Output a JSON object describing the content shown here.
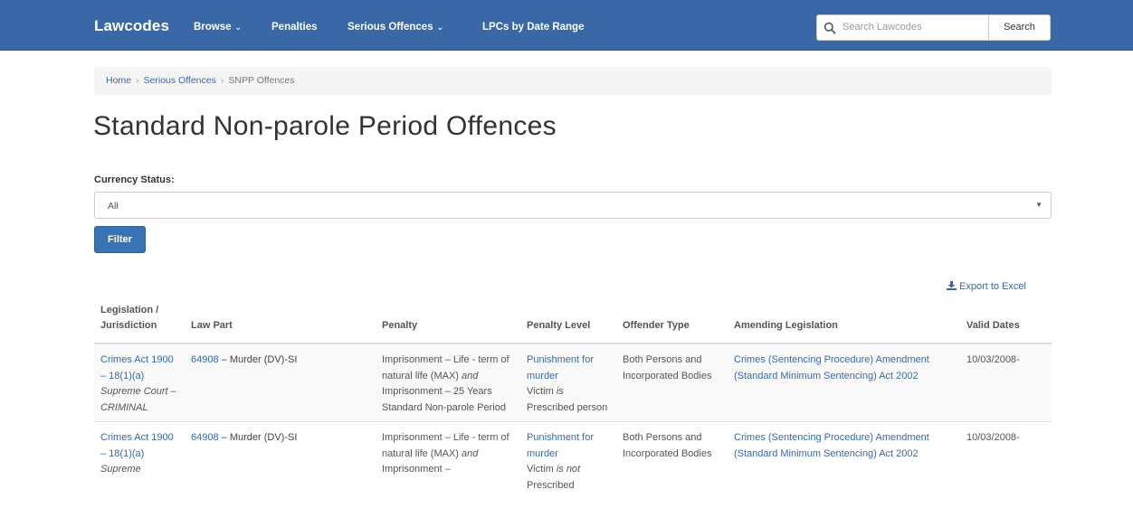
{
  "navbar": {
    "brand": "Lawcodes",
    "links": [
      {
        "label": "Browse",
        "caret": "⌄"
      },
      {
        "label": "Penalties",
        "caret": ""
      },
      {
        "label": "Serious Offences",
        "caret": "⌄"
      },
      {
        "label": "LPCs by Date Range",
        "caret": ""
      }
    ],
    "search_placeholder": "Search Lawcodes",
    "search_button": "Search"
  },
  "breadcrumb": {
    "home": "Home",
    "serious": "Serious Offences",
    "current": "SNPP Offences",
    "separator": "›"
  },
  "page_title": "Standard Non-parole Period Offences",
  "filter": {
    "label": "Currency Status:",
    "selected": "All",
    "button": "Filter"
  },
  "export_label": "Export to Excel",
  "table": {
    "headers": {
      "legislation": "Legislation / Jurisdiction",
      "law_part": "Law Part",
      "penalty": "Penalty",
      "penalty_level": "Penalty Level",
      "offender_type": "Offender Type",
      "amending": "Amending Legislation",
      "valid_dates": "Valid Dates"
    },
    "rows": [
      {
        "leg_link": "Crimes Act 1900 – 18(1)(a)",
        "jurisdiction": "Supreme Court – CRIMINAL",
        "law_code": "64908",
        "law_text": "– Murder (DV)-SI",
        "penalty_1": "Imprisonment – Life - term of natural life (MAX)",
        "penalty_and": "and",
        "penalty_2": "Imprisonment – 25 Years Standard Non-parole Period",
        "level_link": "Punishment for murder",
        "level_pre": "Victim",
        "level_em": "is",
        "level_post": "Prescribed person",
        "offender": "Both Persons and Incorporated Bodies",
        "amending": "Crimes (Sentencing Procedure) Amendment (Standard Minimum Sentencing) Act 2002",
        "valid": "10/03/2008-"
      },
      {
        "leg_link": "Crimes Act 1900 – 18(1)(a)",
        "jurisdiction": "Supreme",
        "law_code": "64908",
        "law_text": "– Murder (DV)-SI",
        "penalty_1": "Imprisonment – Life - term of natural life (MAX)",
        "penalty_and": "and",
        "penalty_2": "Imprisonment –",
        "level_link": "Punishment for murder",
        "level_pre": "Victim",
        "level_em": "is not",
        "level_post": "Prescribed",
        "offender": "Both Persons and Incorporated Bodies",
        "amending": "Crimes (Sentencing Procedure) Amendment (Standard Minimum Sentencing) Act 2002",
        "valid": "10/03/2008-"
      }
    ]
  },
  "colors": {
    "navbar": "#3a68a7",
    "link": "#3a68a7",
    "button": "#3a73b3"
  }
}
